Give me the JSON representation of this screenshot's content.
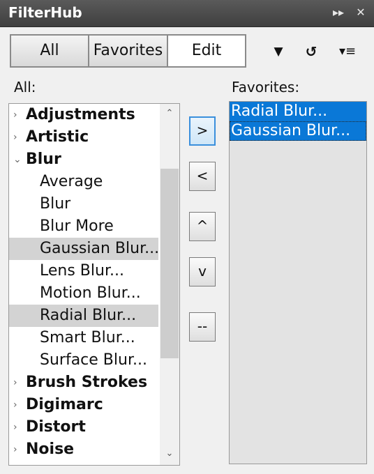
{
  "window": {
    "title": "FilterHub"
  },
  "titlebar": {
    "collapse_icon": "▸▸",
    "close_icon": "✕"
  },
  "tabs": {
    "all": "All",
    "favorites": "Favorites",
    "edit": "Edit"
  },
  "toolbar": {
    "dropdown_icon": "▼",
    "refresh_icon": "↺",
    "menu_icon": "▾≡"
  },
  "labels": {
    "all": "All:",
    "favorites": "Favorites:"
  },
  "tree": [
    {
      "label": "Adjustments",
      "type": "category",
      "chevron": "›"
    },
    {
      "label": "Artistic",
      "type": "category",
      "chevron": "›"
    },
    {
      "label": "Blur",
      "type": "category",
      "chevron": "⌄"
    },
    {
      "label": "Average",
      "type": "child"
    },
    {
      "label": "Blur",
      "type": "child"
    },
    {
      "label": "Blur More",
      "type": "child"
    },
    {
      "label": "Gaussian Blur...",
      "type": "child",
      "highlighted": true
    },
    {
      "label": "Lens Blur...",
      "type": "child"
    },
    {
      "label": "Motion Blur...",
      "type": "child"
    },
    {
      "label": "Radial Blur...",
      "type": "child",
      "highlighted": true
    },
    {
      "label": "Smart Blur...",
      "type": "child"
    },
    {
      "label": "Surface Blur...",
      "type": "child"
    },
    {
      "label": "Brush Strokes",
      "type": "category",
      "chevron": "›"
    },
    {
      "label": "Digimarc",
      "type": "category",
      "chevron": "›"
    },
    {
      "label": "Distort",
      "type": "category",
      "chevron": "›"
    },
    {
      "label": "Noise",
      "type": "category",
      "chevron": "›"
    }
  ],
  "scrollbar": {
    "up": "⌃",
    "down": "⌄"
  },
  "buttons": {
    "add": ">",
    "remove": "<",
    "up": "^",
    "down": "v",
    "separator": "--"
  },
  "favorites": [
    "Radial Blur...",
    "Gaussian Blur..."
  ],
  "colors": {
    "titlebar": "#4a4a4a",
    "selection": "#0a78d7",
    "highlight": "#d3d3d3"
  }
}
